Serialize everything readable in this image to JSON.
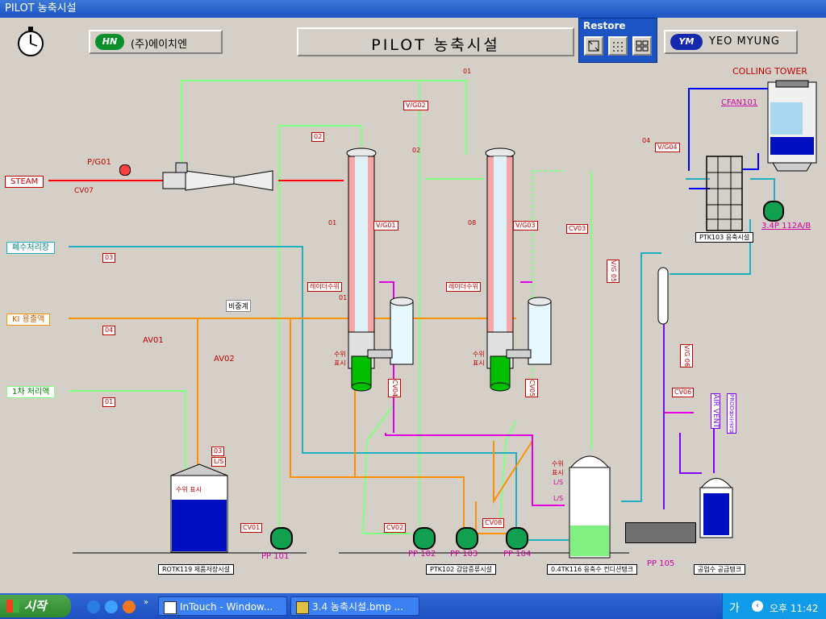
{
  "window": {
    "title": "PILOT 농축시설"
  },
  "header": {
    "company_left": "(주)에이치엔",
    "company_left_logo": "HN",
    "screen_title": "PILOT 농축시설",
    "restore_label": "Restore",
    "company_right_logo": "YM",
    "company_right": "YEO MYUNG"
  },
  "plant": {
    "cooling_tower": "COLLING TOWER",
    "cfan": "CFAN101",
    "steam": "STEAM",
    "pg01": "P/G01",
    "cv07": "CV07",
    "waste_water": "폐수처리장",
    "ki_liquid": "KI 용출액",
    "first_treated": "1차 처리액",
    "fm03": "03",
    "fm04": "04",
    "fm01": "01",
    "fm02": "02",
    "av01": "AV01",
    "av02": "AV02",
    "flowmeter": "비중계",
    "tc01": "01",
    "vg02": "V/G02",
    "stc02": "02",
    "vg01": "V/G01",
    "vg03": "V/G03",
    "vg04": "V/G04",
    "stc04": "04",
    "p01": "01",
    "p08": "08",
    "cv03": "CV03",
    "vg05": "V/G 05",
    "vg06": "V/G 06",
    "reboiler_level1": "레이더수위",
    "reboiler_level1_no": "01",
    "reboiler_level2": "레이더수위",
    "level_disp1": "수위\n표시",
    "level_disp2": "수위\n표시",
    "cv04": "CV04",
    "cv05": "CV05",
    "cv06": "CV06",
    "cv01": "CV01",
    "cv02": "CV02",
    "cv08": "CV08",
    "ls03": "03",
    "ls": "L/S",
    "tank_level": "수위 표시",
    "hp_level": "수위\n표시",
    "ls_a": "L/S",
    "ls_b": "L/S",
    "ptk103": "PTK103 응축시설",
    "pump_3_4": "3.4P 112A/B",
    "air_vent": "AIR VENT",
    "prod_label": "PROD용수공급",
    "pp101": "PP 101",
    "pp102": "PP 102",
    "pp103": "PP 103",
    "pp104": "PP 104",
    "pp105": "PP 105",
    "rotk119": "ROTK119 제품저장시설",
    "ptk102": "PTK102 감압증류시설",
    "tk116": "0.4TK116 응축수 컨디션탱크",
    "supply_tank": "공업수 공급탱크"
  },
  "taskbar": {
    "start": "시작",
    "task1": "InTouch - Window...",
    "task2": "3.4 농축시설.bmp ...",
    "ime": "가",
    "clock": "오후 11:42"
  },
  "colors": {
    "steam": "#ff0000",
    "cyan_line": "#20b0c0",
    "orange_line": "#ff9000",
    "green_line": "#80ff80",
    "magenta_line": "#e000e0",
    "blue_line": "#0000ff",
    "purple_line": "#8000ff"
  }
}
